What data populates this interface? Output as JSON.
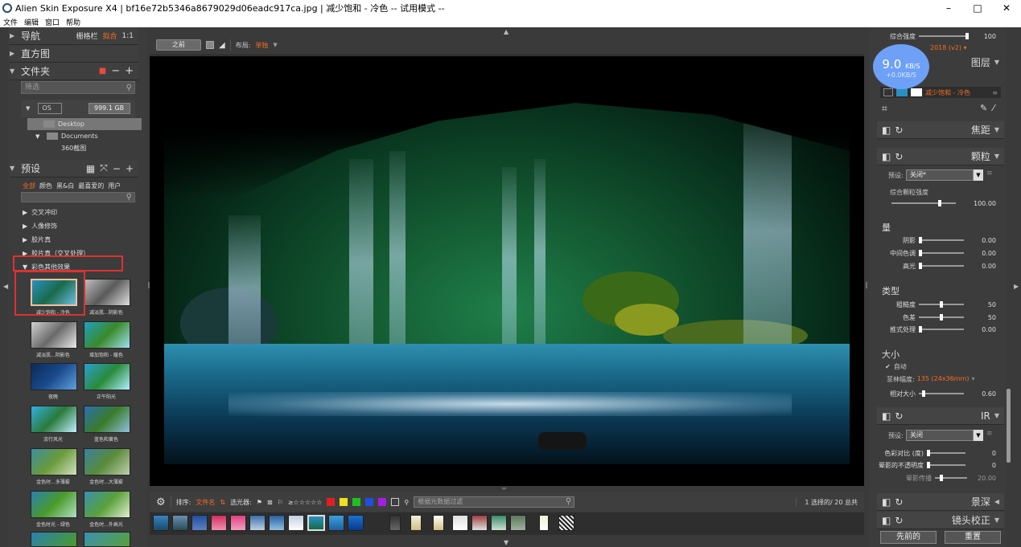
{
  "window": {
    "title": "Alien Skin Exposure X4 | bf16e72b5346a8679029d06eadc917ca.jpg | 减少饱和 - 冷色 -- 试用模式 --",
    "minimize": "–",
    "maximize": "□",
    "close": "✕"
  },
  "menu": [
    "文件",
    "编辑",
    "窗口",
    "帮助"
  ],
  "nav": {
    "label": "导航",
    "grid": "栅格栏",
    "fit": "拟合",
    "one_to_one": "1:1",
    "histogram": "直方图",
    "folders": "文件夹",
    "filter_placeholder": "筛选",
    "drive_name": "OS",
    "drive_size": "999.1 GB",
    "tree": [
      "Desktop",
      "Documents",
      "360截图"
    ]
  },
  "presets": {
    "label": "预设",
    "tabs": [
      "全部",
      "颜色",
      "黑&白",
      "最喜爱的",
      "用户"
    ],
    "categories": [
      "交叉冲印",
      "人像修饰",
      "胶片真",
      "胶片真（交叉处理）",
      "彩色其他效果"
    ],
    "thumbs": [
      "减少饱和 - 冷色",
      "减淡肌...阴影色",
      "减淡肌...阴影色",
      "增加饱和 - 暖色",
      "夜晚",
      "正午阳光",
      "流行风光",
      "蓝色和黄色",
      "金色时...多薄雾",
      "金色时...大薄雾",
      "金色时光 - 绿色",
      "金色时...外高光"
    ]
  },
  "toolbar": {
    "before": "之前",
    "layout_label": "布局:",
    "layout_value": "单独"
  },
  "filterbar": {
    "sort_label": "排序:",
    "sort_value": "文件名",
    "filter_label": "选光器:",
    "search_placeholder": "根据元数据过滤",
    "count": "1 选择的/ 20 总共",
    "colors": [
      "#e02020",
      "#f0e020",
      "#20c020",
      "#2050e0",
      "#a020e0"
    ]
  },
  "right": {
    "overall_strength": "综合强度",
    "overall_value": "100",
    "version": "2018 (v2)",
    "layers": "图层",
    "layer_name": "减少饱和 - 冷色",
    "speed_value": "9.0",
    "speed_unit": "KB/S",
    "speed_sub": "+0.0KB/S",
    "focus": "焦距",
    "grain": "颗粒",
    "preset_label": "预设:",
    "preset_value": "关闭*",
    "grain_strength": "综合颗粒强度",
    "grain_strength_value": "100.00",
    "amount": "量",
    "shadows": "阴影",
    "shadows_value": "0.00",
    "midtones": "中间色调",
    "midtones_value": "0.00",
    "highlights": "高光",
    "highlights_value": "0.00",
    "type": "类型",
    "roughness": "粗糙度",
    "roughness_value": "50",
    "color_diff": "色差",
    "color_diff_value": "50",
    "push": "推式处理",
    "push_value": "0.00",
    "size": "大小",
    "auto": "自动",
    "film_format": "菲林幅度:",
    "film_format_value": "135 (24x36mm)",
    "relative_size": "相对大小",
    "relative_size_value": "0.60",
    "ir": "IR",
    "ir_preset_value": "关闭",
    "color_contrast": "色彩对比 (度)",
    "color_contrast_value": "0",
    "halo_opacity": "晕影的不透明度",
    "halo_opacity_value": "0",
    "halo_spread": "晕影传播",
    "halo_spread_value": "20.00",
    "dof": "景深",
    "lens": "镜头校正",
    "previous": "先前的",
    "reset": "重置"
  }
}
